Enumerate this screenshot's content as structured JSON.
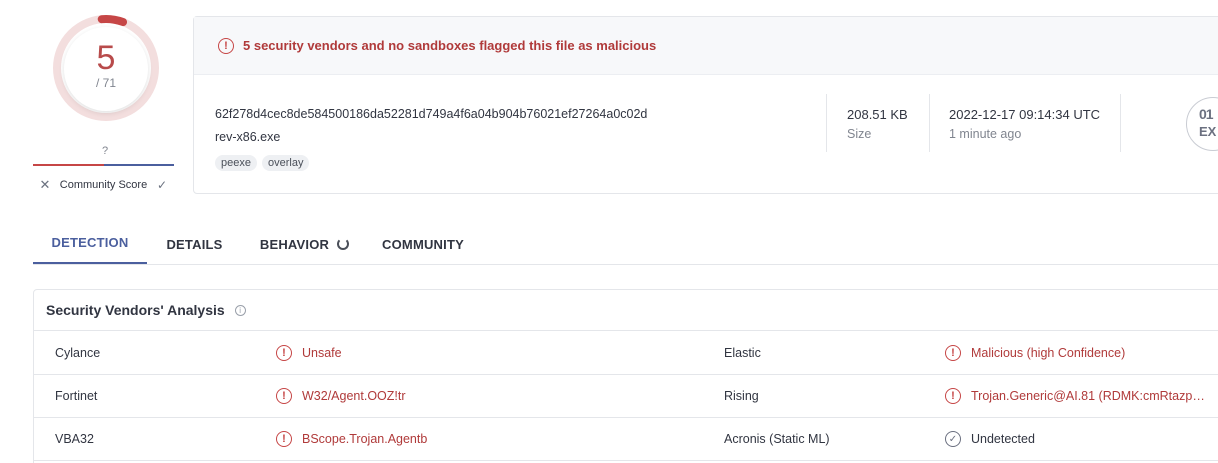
{
  "score": {
    "detections": "5",
    "total": "/ 71",
    "detection_fraction": 0.0704,
    "ring_color": "#c64646",
    "community_score_value": "?",
    "community_score_label": "Community Score",
    "vote_down_icon": "close-icon",
    "vote_up_icon": "check-icon"
  },
  "banner": {
    "icon": "alert-circle-icon",
    "text": "5 security vendors and no sandboxes flagged this file as malicious"
  },
  "file": {
    "hash": "62f278d4cec8de584500186da52281d749a4f6a04b904b76021ef27264a0c02d",
    "name": "rev-x86.exe",
    "tags": [
      "peexe",
      "overlay"
    ],
    "size_value": "208.51 KB",
    "size_label": "Size",
    "date_value": "2022-12-17 09:14:34 UTC",
    "date_label": "1 minute ago",
    "type_icon_text": "EX",
    "type_icon_glyph": "01"
  },
  "tabs": [
    {
      "label": "DETECTION",
      "active": true
    },
    {
      "label": "DETAILS",
      "active": false
    },
    {
      "label": "BEHAVIOR",
      "active": false
    },
    {
      "label": "COMMUNITY",
      "active": false
    }
  ],
  "vendors": {
    "title": "Security Vendors' Analysis",
    "rows": [
      {
        "vendor": "Cylance",
        "result": "Unsafe",
        "vendor2": "Elastic",
        "result2": "Malicious (high Confidence)",
        "result2_status": "malicious"
      },
      {
        "vendor": "Fortinet",
        "result": "W32/Agent.OOZ!tr",
        "vendor2": "Rising",
        "result2": "Trojan.Generic@AI.81 (RDMK:cmRtazp…",
        "result2_status": "malicious"
      },
      {
        "vendor": "VBA32",
        "result": "BScope.Trojan.Agentb",
        "vendor2": "Acronis (Static ML)",
        "result2": "Undetected",
        "result2_status": "undetected"
      }
    ]
  },
  "colors": {
    "malicious": "#b03a3a",
    "accent": "#4b5f9e"
  }
}
